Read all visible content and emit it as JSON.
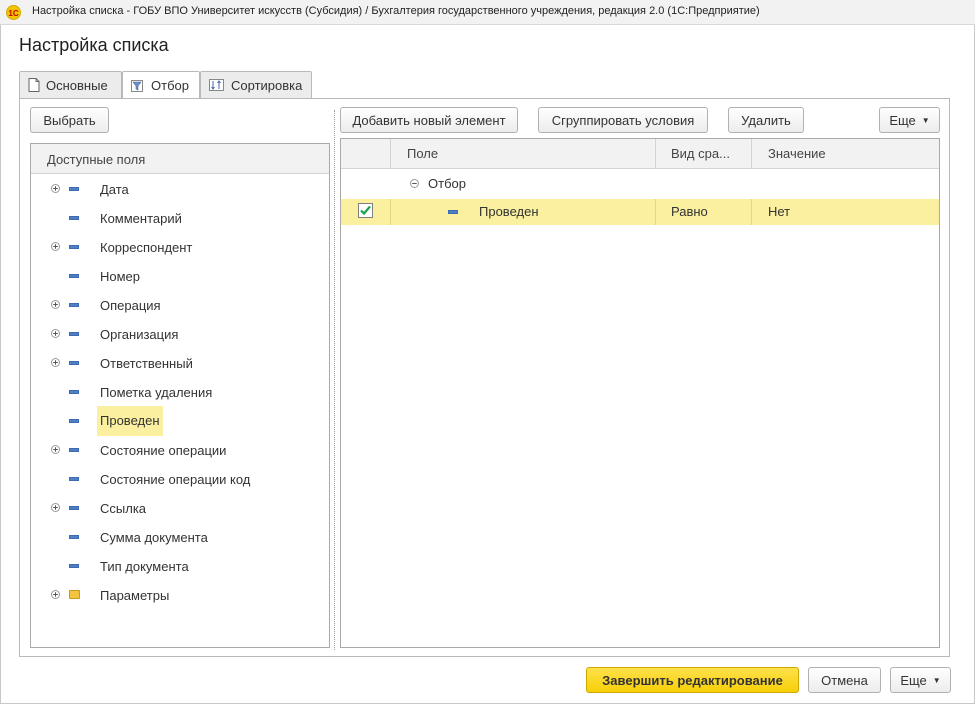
{
  "window": {
    "logo": "1C",
    "title": "Настройка списка - ГОБУ ВПО Университет искусств (Субсидия) / Бухгалтерия государственного учреждения, редакция 2.0  (1С:Предприятие)"
  },
  "form": {
    "title": "Настройка списка"
  },
  "tabs": [
    {
      "label": "Основные",
      "icon": "document-icon",
      "active": false
    },
    {
      "label": "Отбор",
      "icon": "filter-icon",
      "active": true
    },
    {
      "label": "Сортировка",
      "icon": "sort-icon",
      "active": false
    }
  ],
  "left_panel": {
    "select_button": "Выбрать",
    "header": "Доступные поля",
    "items": [
      {
        "label": "Дата",
        "expandable": true,
        "icon": "field-icon"
      },
      {
        "label": "Комментарий",
        "expandable": false,
        "icon": "field-icon"
      },
      {
        "label": "Корреспондент",
        "expandable": true,
        "icon": "field-icon"
      },
      {
        "label": "Номер",
        "expandable": false,
        "icon": "field-icon"
      },
      {
        "label": "Операция",
        "expandable": true,
        "icon": "field-icon"
      },
      {
        "label": "Организация",
        "expandable": true,
        "icon": "field-icon"
      },
      {
        "label": "Ответственный",
        "expandable": true,
        "icon": "field-icon"
      },
      {
        "label": "Пометка удаления",
        "expandable": false,
        "icon": "field-icon"
      },
      {
        "label": "Проведен",
        "expandable": false,
        "icon": "field-icon",
        "selected": true
      },
      {
        "label": "Состояние операции",
        "expandable": true,
        "icon": "field-icon"
      },
      {
        "label": "Состояние операции код",
        "expandable": false,
        "icon": "field-icon"
      },
      {
        "label": "Ссылка",
        "expandable": true,
        "icon": "field-icon"
      },
      {
        "label": "Сумма документа",
        "expandable": false,
        "icon": "field-icon"
      },
      {
        "label": "Тип документа",
        "expandable": false,
        "icon": "field-icon"
      },
      {
        "label": "Параметры",
        "expandable": true,
        "icon": "folder-icon"
      }
    ]
  },
  "toolbar": {
    "add_label": "Добавить новый элемент",
    "group_label": "Сгруппировать условия",
    "delete_label": "Удалить",
    "more_label": "Еще"
  },
  "filter_table": {
    "columns": [
      "Поле",
      "Вид сра...",
      "Значение"
    ],
    "group_label": "Отбор",
    "rows": [
      {
        "checked": true,
        "field": "Проведен",
        "comparison": "Равно",
        "value": "Нет"
      }
    ]
  },
  "footer": {
    "finish_label": "Завершить редактирование",
    "cancel_label": "Отмена",
    "more_label": "Еще"
  },
  "colors": {
    "accent_yellow": "#f6cf08",
    "selection": "#faf0a0",
    "field_icon": "#4f7fc9",
    "check": "#1aa34a"
  }
}
